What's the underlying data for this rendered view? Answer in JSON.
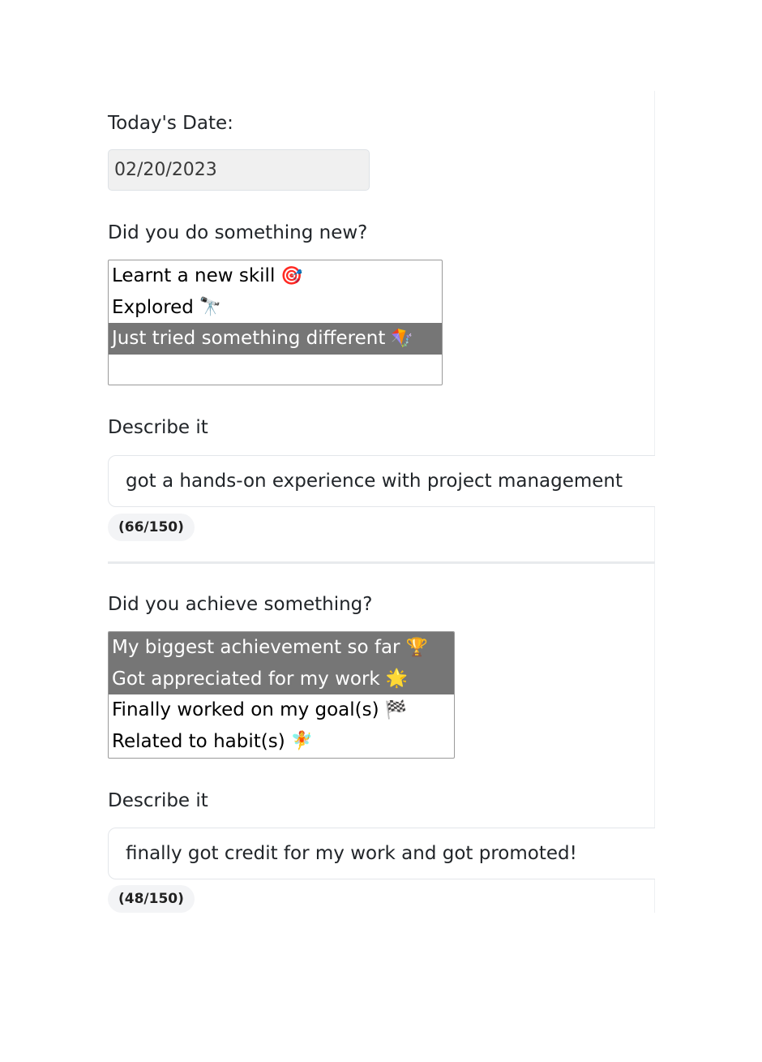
{
  "date_section": {
    "label": "Today's Date:",
    "value": "02/20/2023"
  },
  "new_section": {
    "question": "Did you do something new?",
    "options": [
      {
        "label": "Learnt a new skill",
        "emoji": "🎯",
        "selected": false
      },
      {
        "label": "Explored",
        "emoji": "🔭",
        "selected": false
      },
      {
        "label": "Just tried something different",
        "emoji": "🪁",
        "selected": true
      }
    ],
    "describe_label": "Describe it",
    "describe_value": "got a hands-on experience with project management",
    "counter": "(66/150)"
  },
  "achieve_section": {
    "question": "Did you achieve something?",
    "options": [
      {
        "label": "My biggest achievement so far",
        "emoji": "🏆",
        "selected": true
      },
      {
        "label": "Got appreciated for my work",
        "emoji": "🌟",
        "selected": true
      },
      {
        "label": "Finally worked on my goal(s)",
        "emoji": "🏁",
        "selected": false
      },
      {
        "label": "Related to habit(s)",
        "emoji": "🧚",
        "selected": false
      }
    ],
    "describe_label": "Describe it",
    "describe_value": "finally got credit for my work and got promoted!",
    "counter": "(48/150)"
  },
  "colors": {
    "selected_option_bg": "#767676",
    "counter_bg": "#f3f4f6",
    "date_input_bg": "#f0f0f0"
  }
}
